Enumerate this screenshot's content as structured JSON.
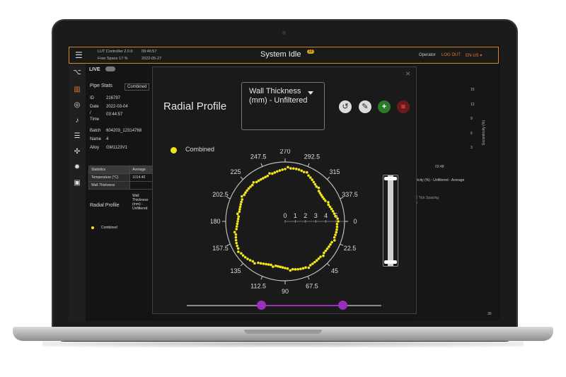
{
  "header": {
    "menu_icon": "hamburger-icon",
    "version": "LUT Controller 2.0.0",
    "clock": "09:46:57",
    "free_space": "Free Space 17 %",
    "date": "2022-05-27",
    "title": "System Idle",
    "badge": "19",
    "user": "Operator",
    "logout": "LOG OUT",
    "lang": "EN-US"
  },
  "left_panel": {
    "live": "LIVE",
    "pipe_stats": "Pipe Stats",
    "mode": "Combined",
    "id_label": "ID",
    "id": "216797",
    "date_label": "Date",
    "date": "2022-03-04",
    "slash": "/",
    "time_label": "Time",
    "time": "03:44:57",
    "batch_label": "Batch",
    "batch": "604203_12314768",
    "name_label": "Name",
    "name": "4",
    "alloy_label": "Alloy",
    "alloy": "GM1123V1",
    "stats_header": "Statistics",
    "avg_header": "Average",
    "temp_label": "Temperature (°C)",
    "temp": "1014.40",
    "wall_label": "Wall Thickness",
    "radial_profile": "Radial Profile",
    "wall_option": "Wall Thickness (mm) - Unfiltered",
    "combined": "Combined"
  },
  "right_panel": {
    "ticks": [
      "15",
      "12",
      "9",
      "6",
      "3"
    ],
    "time": "03:48",
    "eccentricity": "Eccentricity (%)",
    "caption": "tricity (%) - Unfiltered - Average",
    "tick_spacing": "X Tick Spacing",
    "tick_value": "5",
    "x_end": "30"
  },
  "modal": {
    "title": "Radial Profile",
    "dropdown_value": "Wall Thickness (mm) - Unfiltered",
    "legend": "Combined",
    "legend_color": "#f2e61a",
    "angles": [
      "0",
      "22.5",
      "45",
      "67.5",
      "90",
      "112.5",
      "135",
      "157.5",
      "180",
      "202.5",
      "225",
      "247.5",
      "270",
      "292.5",
      "315",
      "337.5"
    ],
    "radial_ticks": [
      "0",
      "1",
      "2",
      "3",
      "4",
      "5"
    ],
    "accent": "#9b2fbd"
  }
}
